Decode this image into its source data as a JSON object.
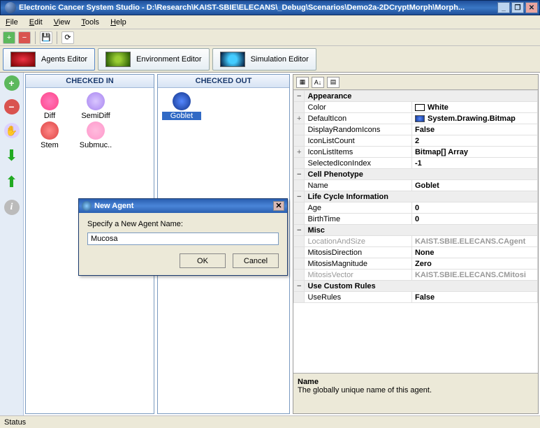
{
  "window": {
    "title": "Electronic Cancer System Studio - D:\\Research\\KAIST-SBIE\\ELECANS\\_Debug\\Scenarios\\Demo2a-2DCryptMorph\\Morph..."
  },
  "menu": {
    "file": "File",
    "edit": "Edit",
    "view": "View",
    "tools": "Tools",
    "help": "Help"
  },
  "toolbar": {
    "new": "+",
    "del": "−",
    "save": "💾",
    "refresh": "⟳"
  },
  "editorTabs": {
    "agents": "Agents Editor",
    "environment": "Environment Editor",
    "simulation": "Simulation Editor"
  },
  "panels": {
    "checkedin": {
      "title": "CHECKED IN",
      "items": [
        {
          "label": "Diff"
        },
        {
          "label": "SemiDiff"
        },
        {
          "label": "Stem"
        },
        {
          "label": "Submuc.."
        }
      ]
    },
    "checkedout": {
      "title": "CHECKED OUT",
      "items": [
        {
          "label": "Goblet",
          "selected": true
        }
      ]
    }
  },
  "properties": {
    "categories": [
      {
        "name": "Appearance",
        "rows": [
          {
            "k": "Color",
            "v": "White",
            "swatch": "#ffffff"
          },
          {
            "k": "DefaultIcon",
            "v": "System.Drawing.Bitmap",
            "expand": "+",
            "icon": true
          },
          {
            "k": "DisplayRandomIcons",
            "v": "False"
          },
          {
            "k": "IconListCount",
            "v": "2"
          },
          {
            "k": "IconListItems",
            "v": "Bitmap[] Array",
            "expand": "+"
          },
          {
            "k": "SelectedIconIndex",
            "v": "-1"
          }
        ]
      },
      {
        "name": "Cell Phenotype",
        "rows": [
          {
            "k": "Name",
            "v": "Goblet"
          }
        ]
      },
      {
        "name": "Life Cycle Information",
        "rows": [
          {
            "k": "Age",
            "v": "0"
          },
          {
            "k": "BirthTime",
            "v": "0"
          }
        ]
      },
      {
        "name": "Misc",
        "rows": [
          {
            "k": "LocationAndSize",
            "v": "KAIST.SBIE.ELECANS.CAgent",
            "dim": true
          },
          {
            "k": "MitosisDirection",
            "v": "None"
          },
          {
            "k": "MitosisMagnitude",
            "v": "Zero"
          },
          {
            "k": "MitosisVector",
            "v": "KAIST.SBIE.ELECANS.CMitosi",
            "dim": true
          }
        ]
      },
      {
        "name": "Use Custom Rules",
        "rows": [
          {
            "k": "UseRules",
            "v": "False"
          }
        ]
      }
    ],
    "description": {
      "title": "Name",
      "body": "The globally unique name of this agent."
    }
  },
  "dialog": {
    "title": "New Agent",
    "prompt": "Specify a New Agent Name:",
    "value": "Mucosa",
    "ok": "OK",
    "cancel": "Cancel"
  },
  "status": "Status"
}
